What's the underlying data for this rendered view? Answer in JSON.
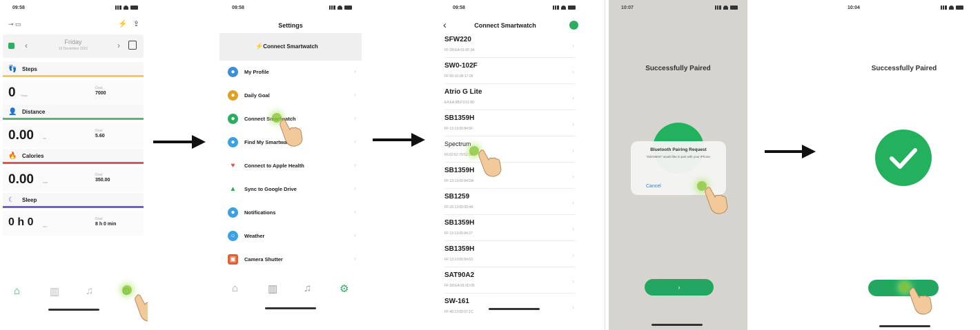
{
  "screen1": {
    "status_time": "09:58",
    "top_left": "⊸ ▭",
    "day": "Friday",
    "date": "10 December 2021",
    "metrics": [
      {
        "label": "Steps",
        "icon": "👣",
        "value": "0",
        "unit": "Steps",
        "goal_label": "Goal",
        "goal": "7000",
        "color": "#f2cd3c"
      },
      {
        "label": "Distance",
        "icon": "👤",
        "value": "0.00",
        "unit": "km",
        "goal_label": "Goal",
        "goal": "5.60",
        "color": "#55b57b"
      },
      {
        "label": "Calories",
        "icon": "🔥",
        "value": "0.00",
        "unit": "kcal",
        "goal_label": "Goal",
        "goal": "350.00",
        "color": "#ea4f4f"
      },
      {
        "label": "Sleep",
        "icon": "☾",
        "value": "0 h 0",
        "unit": "min",
        "goal_label": "Goal",
        "goal": "8 h 0 min",
        "color": "#6c5ecf"
      }
    ]
  },
  "screen2": {
    "status_time": "09:58",
    "title": "Settings",
    "connect_label": "Connect Smartwatch",
    "items": [
      {
        "label": "My Profile",
        "color": "#3b8fd9"
      },
      {
        "label": "Daily Goal",
        "color": "#e0a020"
      },
      {
        "label": "Connect Smartwatch",
        "color": "#2cae61"
      },
      {
        "label": "Find My Smartwatch",
        "color": "#3aa0e0"
      },
      {
        "label": "Connect to Apple Health",
        "color": "#ea4f4f"
      },
      {
        "label": "Sync to Google Drive",
        "color": "#34a853"
      },
      {
        "label": "Notifications",
        "color": "#3aa0e0"
      },
      {
        "label": "Weather",
        "color": "#3aa0e0"
      },
      {
        "label": "Camera Shutter",
        "color": "#e06030"
      }
    ]
  },
  "screen3": {
    "status_time": "09:58",
    "title": "Connect Smartwatch",
    "devices": [
      {
        "name": "SFW220",
        "mac": "FF:D8:EA:01:0F:3A"
      },
      {
        "name": "SW0-102F",
        "mac": "FF:00:16:1B:17:26"
      },
      {
        "name": "Atrio G Lite",
        "mac": "E4:EA:9B:F3:51:9D"
      },
      {
        "name": "SB1359H",
        "mac": "FF:13:13:00:84:5F"
      },
      {
        "name": "Spectrum",
        "mac": "F6:02:62:79:52:1B"
      },
      {
        "name": "SB1359H",
        "mac": "FF:13:13:00:84:DA"
      },
      {
        "name": "SB1259",
        "mac": "FF:16:13:00:00:4A"
      },
      {
        "name": "SB1359H",
        "mac": "FF:13:13:00:84:27"
      },
      {
        "name": "SB1359H",
        "mac": "FF:13:13:00:84:63"
      },
      {
        "name": "SAT90A2",
        "mac": "FF:D8:EA:01:0D:05"
      },
      {
        "name": "SW-161",
        "mac": "FF:40:13:00:07:1C"
      }
    ]
  },
  "screen4": {
    "status_time": "10:07",
    "title": "Successfully Paired",
    "dialog_title": "Bluetooth Pairing Request",
    "dialog_body": "\"SW1950H\" would like to pair with your iPhone.",
    "cancel": "Cancel",
    "button_label": "›"
  },
  "screen5": {
    "status_time": "10:04",
    "title": "Successfully Paired"
  },
  "tabbar": {
    "home": "⌂",
    "stats": "▥",
    "bell": "♫",
    "gear": "⚙"
  }
}
